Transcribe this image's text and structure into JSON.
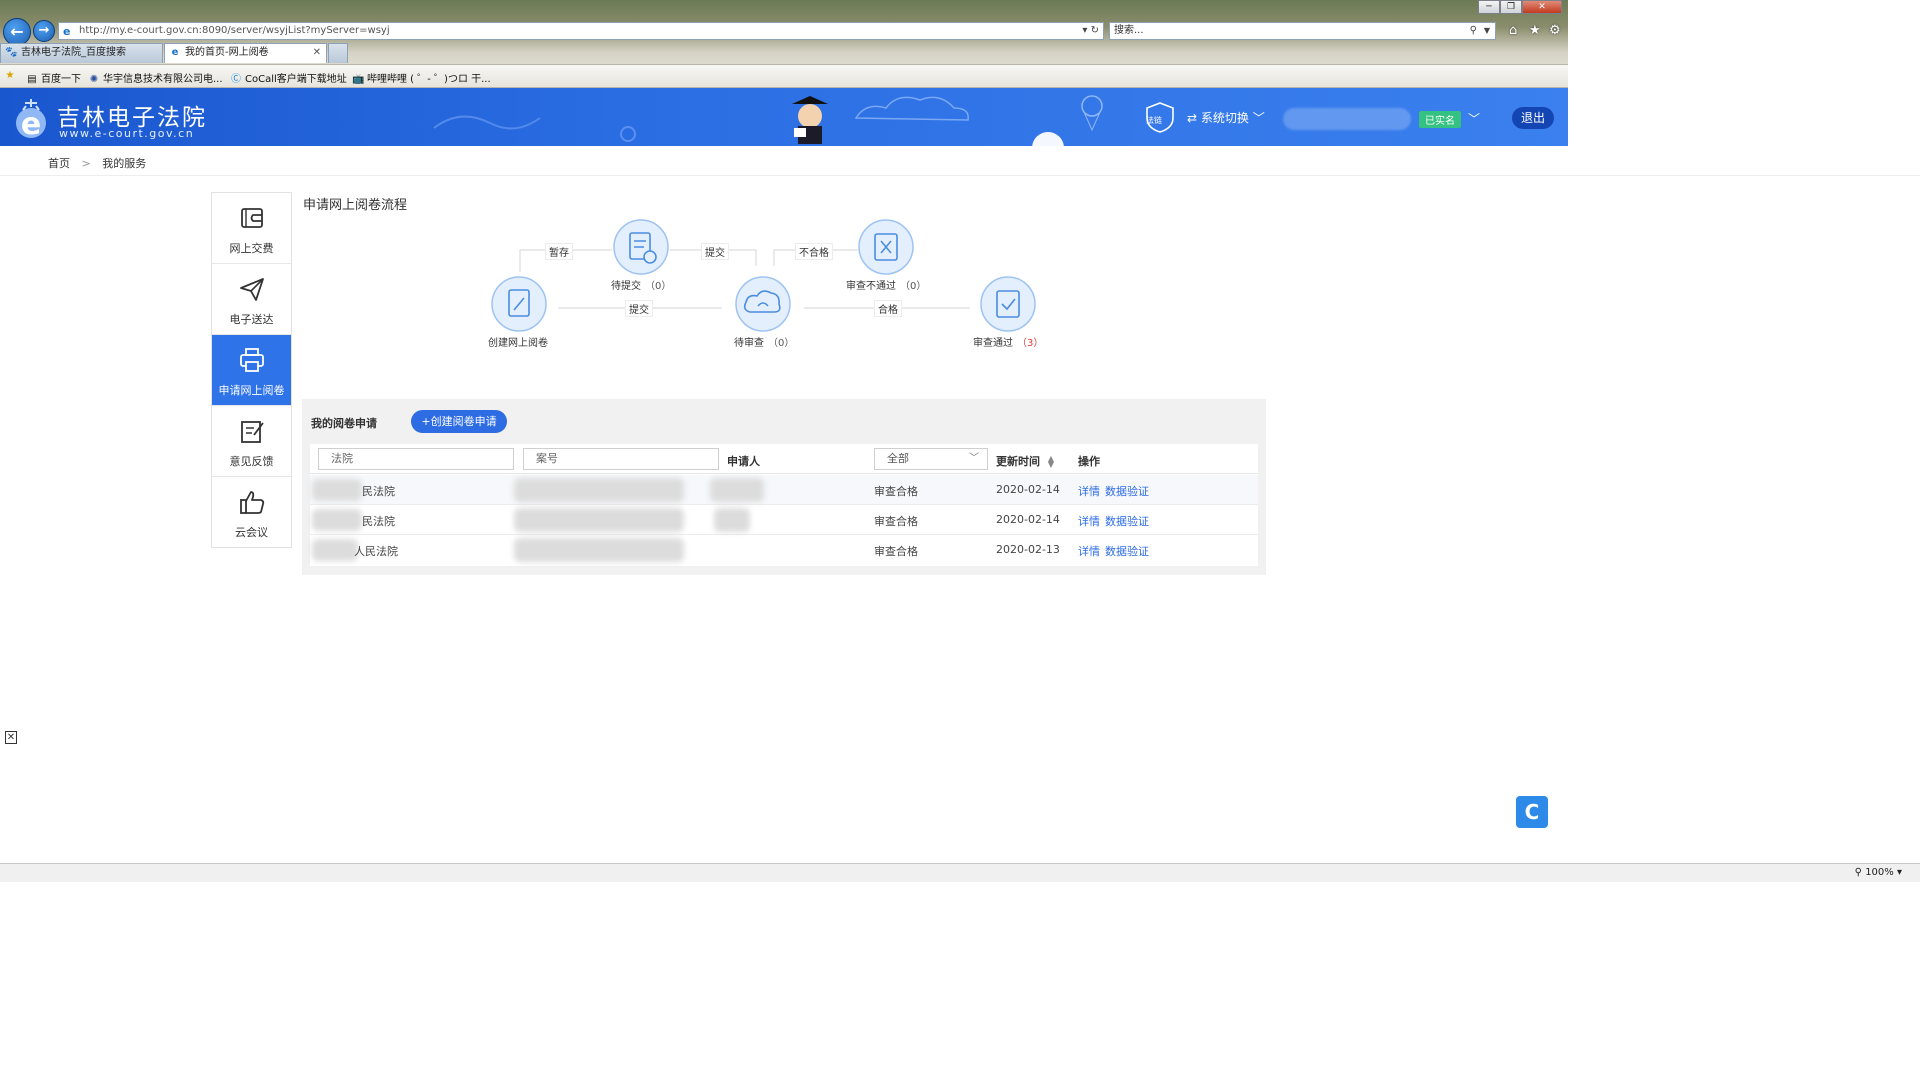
{
  "browser": {
    "url": "http://my.e-court.gov.cn:8090/server/wsyjList?myServer=wsyj",
    "search_placeholder": "搜索...",
    "tabs": [
      {
        "label": "吉林电子法院_百度搜索"
      },
      {
        "label": "我的首页-网上阅卷"
      }
    ],
    "favorites": [
      {
        "label": "百度一下"
      },
      {
        "label": "华宇信息技术有限公司电..."
      },
      {
        "label": "CoCall客户端下载地址"
      },
      {
        "label": "哔哩哔哩 ( ゜- ゜)つロ 干..."
      }
    ],
    "zoom": "100%"
  },
  "header": {
    "title": "吉林电子法院",
    "url_text": "www.e-court.gov.cn",
    "badge_text": "法链",
    "switch_label": "系统切换",
    "realname_label": "已实名",
    "logout_label": "退出",
    "brand_color": "#2c6fe4"
  },
  "breadcrumb": {
    "home": "首页",
    "current": "我的服务"
  },
  "side_menu": [
    {
      "label": "网上交费",
      "icon": "wallet-icon",
      "active": false
    },
    {
      "label": "电子送达",
      "icon": "paper-plane-icon",
      "active": false
    },
    {
      "label": "申请网上阅卷",
      "icon": "printer-icon",
      "active": true
    },
    {
      "label": "意见反馈",
      "icon": "edit-note-icon",
      "active": false
    },
    {
      "label": "云会议",
      "icon": "thumbs-up-icon",
      "active": false
    }
  ],
  "flow": {
    "title": "申请网上阅卷流程",
    "nodes": {
      "create": {
        "label": "创建网上阅卷",
        "count": ""
      },
      "pending_submit": {
        "label": "待提交",
        "count": "（0）"
      },
      "pending_review": {
        "label": "待审查",
        "count": "（0）"
      },
      "review_fail": {
        "label": "审查不通过",
        "count": "（0）"
      },
      "review_pass": {
        "label": "审查通过",
        "count": "（3）"
      }
    },
    "edges": {
      "save": "暂存",
      "submit_top": "提交",
      "submit_bottom": "提交",
      "fail": "不合格",
      "pass": "合格"
    }
  },
  "applications": {
    "title": "我的阅卷申请",
    "create_button": "+创建阅卷申请",
    "filters": {
      "court_placeholder": "法院",
      "case_placeholder": "案号",
      "status_selected": "全部"
    },
    "columns": {
      "applicant": "申请人",
      "updated": "更新时间",
      "action": "操作"
    },
    "rows": [
      {
        "court": "民法院",
        "status": "审查合格",
        "updated": "2020-02-14",
        "detail": "详情",
        "verify": "数据验证"
      },
      {
        "court": "民法院",
        "status": "审查合格",
        "updated": "2020-02-14",
        "detail": "详情",
        "verify": "数据验证"
      },
      {
        "court": "人民法院",
        "status": "审查合格",
        "updated": "2020-02-13",
        "detail": "详情",
        "verify": "数据验证"
      }
    ]
  }
}
